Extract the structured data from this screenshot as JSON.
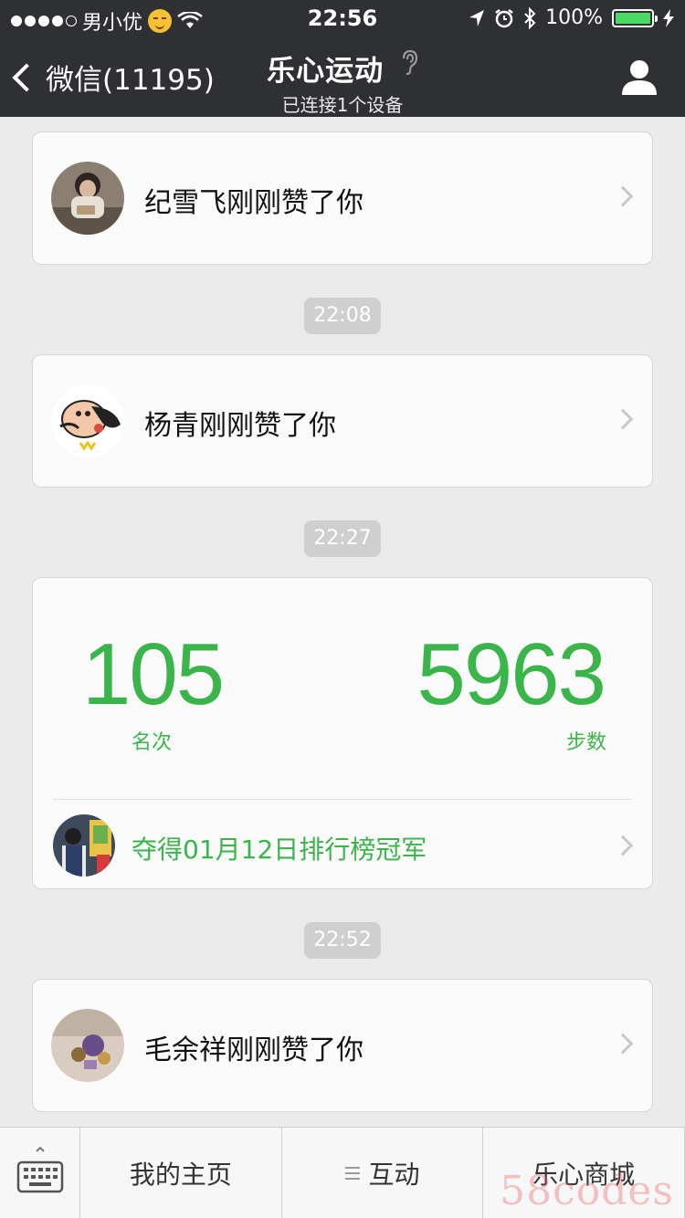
{
  "status_bar": {
    "carrier": "男小优",
    "time": "22:56",
    "battery": "100%"
  },
  "nav": {
    "back_label": "微信(11195)",
    "title": "乐心运动",
    "subtitle": "已连接1个设备"
  },
  "feed": {
    "likes": [
      {
        "text": "纪雪飞刚刚赞了你"
      },
      {
        "text": "杨青刚刚赞了你"
      },
      {
        "text": "毛余祥刚刚赞了你"
      }
    ],
    "timestamps": [
      "22:08",
      "22:27",
      "22:52"
    ],
    "stats": {
      "rank_value": "105",
      "rank_label": "名次",
      "steps_value": "5963",
      "steps_label": "步数",
      "champion_text": "夺得01月12日排行榜冠军"
    }
  },
  "bottom_bar": {
    "tabs": [
      "我的主页",
      "互动",
      "乐心商城"
    ]
  },
  "watermark": "58codes",
  "colors": {
    "nav_bg": "#2f3033",
    "accent_green": "#3ab54a",
    "page_bg": "#ebebeb",
    "pill_bg": "#cfcfcf"
  }
}
